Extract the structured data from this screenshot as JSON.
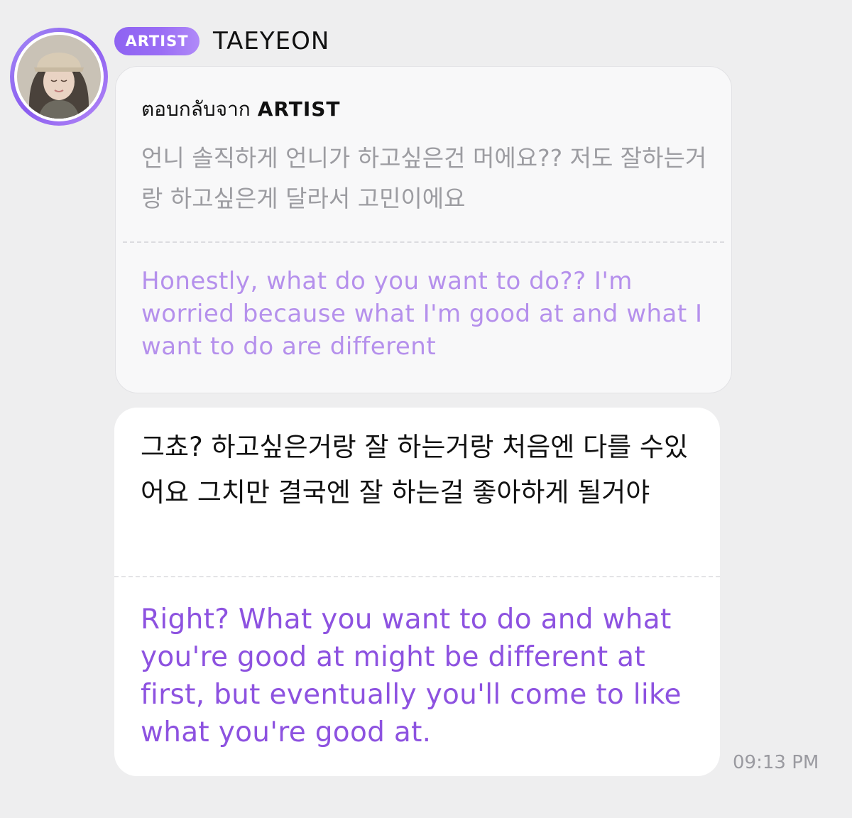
{
  "header": {
    "badge_label": "ARTIST",
    "artist_name": "TAEYEON"
  },
  "quote": {
    "reply_prefix": "ตอบกลับจาก",
    "reply_author": "ARTIST",
    "original_text": "언니 솔직하게 언니가 하고싶은건 머에요?? 저도 잘하는거랑 하고싶은게 달라서 고민이에요",
    "translation_text": "Honestly, what do you want to do?? I'm worried because what I'm good at and what I want to do are different"
  },
  "reply": {
    "original_text": "그쵸? 하고싶은거랑 잘 하는거랑 처음엔 다를 수있어요 그치만 결국엔 잘 하는걸 좋아하게 될거야",
    "translation_text": "Right? What you want to do and what you're good at might be different at first, but eventually you'll come to like what you're good at.",
    "timestamp": "09:13 PM"
  },
  "colors": {
    "background": "#eeeeef",
    "badge_gradient_start": "#8e63f2",
    "badge_gradient_end": "#b08af8",
    "quote_translation": "#b590ec",
    "reply_translation": "#8d52e0",
    "muted_text": "#9c9ca1"
  }
}
